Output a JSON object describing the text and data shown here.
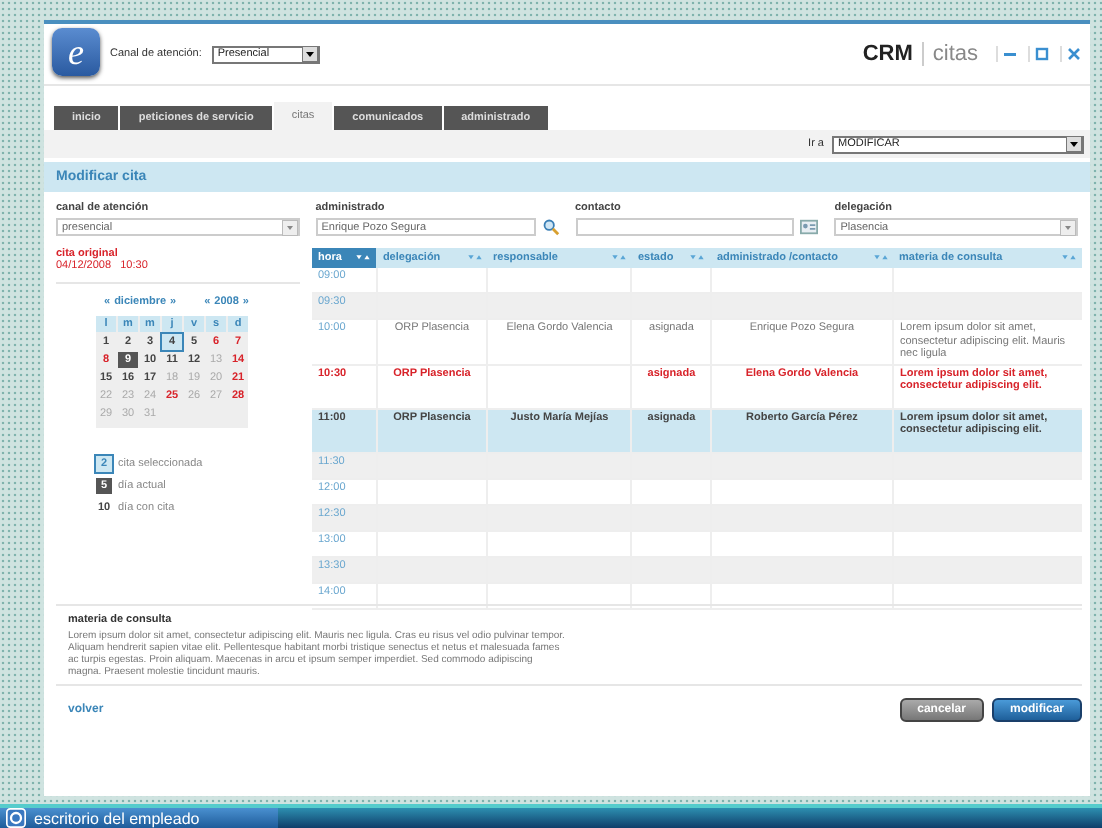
{
  "header": {
    "logo": "e",
    "channel_label": "Canal de atención:",
    "channel_value": "Presencial",
    "app_name": "CRM",
    "section": "citas"
  },
  "tabs": [
    {
      "label": "inicio",
      "selected": false
    },
    {
      "label": "peticiones de servicio",
      "selected": false
    },
    {
      "label": "citas",
      "selected": true
    },
    {
      "label": "comunicados",
      "selected": false
    },
    {
      "label": "administrado",
      "selected": false
    }
  ],
  "goto": {
    "label": "Ir a",
    "value": "MODIFICAR"
  },
  "page_title": "Modificar cita",
  "form": [
    {
      "label": "canal de atención",
      "value": "presencial",
      "kind": "select"
    },
    {
      "label": "administrado",
      "value": "Enrique Pozo Segura",
      "kind": "search"
    },
    {
      "label": "contacto",
      "kind": "contact"
    },
    {
      "label": "delegación",
      "value": "Plasencia",
      "kind": "select"
    }
  ],
  "original": {
    "label": "cita original",
    "date": "04/12/2008",
    "time": "10:30"
  },
  "calendar": {
    "month": "diciembre",
    "year": "2008",
    "prev": "«",
    "next": "»",
    "weekdays": [
      "l",
      "m",
      "m",
      "j",
      "v",
      "s",
      "d"
    ],
    "days": [
      {
        "day": "1",
        "appointment": true,
        "red": false,
        "selected": false,
        "today": false
      },
      {
        "day": "2",
        "appointment": true,
        "red": false,
        "selected": false,
        "today": false
      },
      {
        "day": "3",
        "appointment": true,
        "red": false,
        "selected": false,
        "today": false
      },
      {
        "day": "4",
        "appointment": true,
        "red": false,
        "selected": true,
        "today": false
      },
      {
        "day": "5",
        "appointment": true,
        "red": false,
        "selected": false,
        "today": false
      },
      {
        "day": "6",
        "appointment": true,
        "red": true,
        "selected": false,
        "today": false
      },
      {
        "day": "7",
        "appointment": true,
        "red": true,
        "selected": false,
        "today": false
      },
      {
        "day": "8",
        "appointment": true,
        "red": true,
        "selected": false,
        "today": false
      },
      {
        "day": "9",
        "appointment": true,
        "red": false,
        "selected": false,
        "today": true
      },
      {
        "day": "10",
        "appointment": true,
        "red": false,
        "selected": false,
        "today": false
      },
      {
        "day": "11",
        "appointment": true,
        "red": false,
        "selected": false,
        "today": false
      },
      {
        "day": "12",
        "appointment": true,
        "red": false,
        "selected": false,
        "today": false
      },
      {
        "day": "13",
        "appointment": false,
        "red": false,
        "selected": false,
        "today": false
      },
      {
        "day": "14",
        "appointment": true,
        "red": true,
        "selected": false,
        "today": false
      },
      {
        "day": "15",
        "appointment": true,
        "red": false,
        "selected": false,
        "today": false
      },
      {
        "day": "16",
        "appointment": true,
        "red": false,
        "selected": false,
        "today": false
      },
      {
        "day": "17",
        "appointment": true,
        "red": false,
        "selected": false,
        "today": false
      },
      {
        "day": "18",
        "appointment": false,
        "red": false,
        "selected": false,
        "today": false
      },
      {
        "day": "19",
        "appointment": false,
        "red": false,
        "selected": false,
        "today": false
      },
      {
        "day": "20",
        "appointment": false,
        "red": false,
        "selected": false,
        "today": false
      },
      {
        "day": "21",
        "appointment": true,
        "red": true,
        "selected": false,
        "today": false
      },
      {
        "day": "22",
        "appointment": false,
        "red": false,
        "selected": false,
        "today": false
      },
      {
        "day": "23",
        "appointment": false,
        "red": false,
        "selected": false,
        "today": false
      },
      {
        "day": "24",
        "appointment": false,
        "red": false,
        "selected": false,
        "today": false
      },
      {
        "day": "25",
        "appointment": true,
        "red": true,
        "selected": false,
        "today": false
      },
      {
        "day": "26",
        "appointment": false,
        "red": false,
        "selected": false,
        "today": false
      },
      {
        "day": "27",
        "appointment": false,
        "red": false,
        "selected": false,
        "today": false
      },
      {
        "day": "28",
        "appointment": true,
        "red": true,
        "selected": false,
        "today": false
      },
      {
        "day": "29",
        "appointment": false,
        "red": false,
        "selected": false,
        "today": false
      },
      {
        "day": "30",
        "appointment": false,
        "red": false,
        "selected": false,
        "today": false
      },
      {
        "day": "31",
        "appointment": false,
        "red": false,
        "selected": false,
        "today": false
      }
    ]
  },
  "legend": [
    {
      "kind": "selected",
      "sample": "2",
      "label": "cita seleccionada"
    },
    {
      "kind": "today",
      "sample": "5",
      "label": "día actual"
    },
    {
      "kind": "appointment",
      "sample": "10",
      "label": "día con cita"
    }
  ],
  "table": {
    "columns": [
      "hora",
      "delegación",
      "responsable",
      "estado",
      "administrado /contacto",
      "materia de consulta"
    ],
    "rows": [
      {
        "kind": "empty",
        "cells": [
          "09:00"
        ]
      },
      {
        "kind": "empty",
        "cells": [
          "09:30"
        ]
      },
      {
        "kind": "normal",
        "cells": [
          "10:00",
          "ORP Plasencia",
          "Elena Gordo Valencia",
          "asignada",
          "Enrique Pozo Segura",
          "Lorem ipsum dolor sit amet, consectetur adipiscing elit. Mauris nec ligula"
        ]
      },
      {
        "kind": "original",
        "cells": [
          "10:30",
          "ORP Plasencia",
          "",
          "asignada",
          "Elena Gordo Valencia",
          "Lorem ipsum dolor sit amet, consectetur adipiscing elit."
        ]
      },
      {
        "kind": "selected",
        "cells": [
          "11:00",
          "ORP Plasencia",
          "Justo María Mejías",
          "asignada",
          "Roberto García Pérez",
          "Lorem ipsum dolor sit amet, consectetur adipiscing elit."
        ]
      },
      {
        "kind": "empty",
        "cells": [
          "11:30"
        ]
      },
      {
        "kind": "empty",
        "cells": [
          "12:00"
        ]
      },
      {
        "kind": "empty",
        "cells": [
          "12:30"
        ]
      },
      {
        "kind": "empty",
        "cells": [
          "13:00"
        ]
      },
      {
        "kind": "empty",
        "cells": [
          "13:30"
        ]
      },
      {
        "kind": "empty",
        "cells": [
          "14:00"
        ]
      }
    ]
  },
  "details": {
    "title": "materia de consulta",
    "text": "Lorem ipsum dolor sit amet, consectetur adipiscing elit. Mauris nec ligula. Cras eu risus vel odio pulvinar tempor. Aliquam hendrerit sapien vitae elit. Pellentesque habitant morbi tristique senectus et netus et malesuada fames ac turpis egestas. Proin aliquam. Maecenas in arcu et ipsum semper imperdiet. Sed commodo adipiscing magna. Praesent molestie tincidunt mauris."
  },
  "footer": {
    "back": "volver",
    "buttons": [
      {
        "label": "cancelar",
        "kind": "secondary"
      },
      {
        "label": "modificar",
        "kind": "primary"
      }
    ]
  },
  "taskbar": {
    "label": "escritorio del empleado"
  }
}
